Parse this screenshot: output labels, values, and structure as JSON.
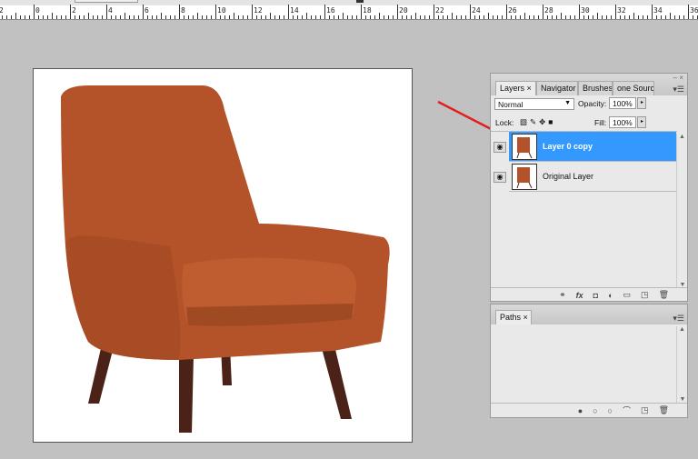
{
  "ruler": {
    "labels": [
      "2",
      "0",
      "2",
      "4",
      "6",
      "8",
      "10",
      "12",
      "14",
      "16",
      "18",
      "20",
      "22",
      "24",
      "26",
      "28",
      "30",
      "32",
      "34",
      "36"
    ]
  },
  "layers_panel": {
    "tabs": [
      "Layers ×",
      "Navigator",
      "Brushes",
      "one Source"
    ],
    "blend_mode": "Normal",
    "opacity_label": "Opacity:",
    "opacity_value": "100%",
    "lock_label": "Lock:",
    "fill_label": "Fill:",
    "fill_value": "100%",
    "layers": [
      {
        "name": "Layer 0 copy",
        "selected": true
      },
      {
        "name": "Original Layer",
        "selected": false
      }
    ],
    "footer_icons": [
      "link-icon",
      "fx-icon",
      "mask-icon",
      "adjustment-icon",
      "folder-icon",
      "new-layer-icon",
      "trash-icon"
    ]
  },
  "paths_panel": {
    "tab": "Paths ×"
  },
  "colors": {
    "selection": "#3399ff",
    "arrow": "#e02020",
    "chair": "#b4532a"
  }
}
